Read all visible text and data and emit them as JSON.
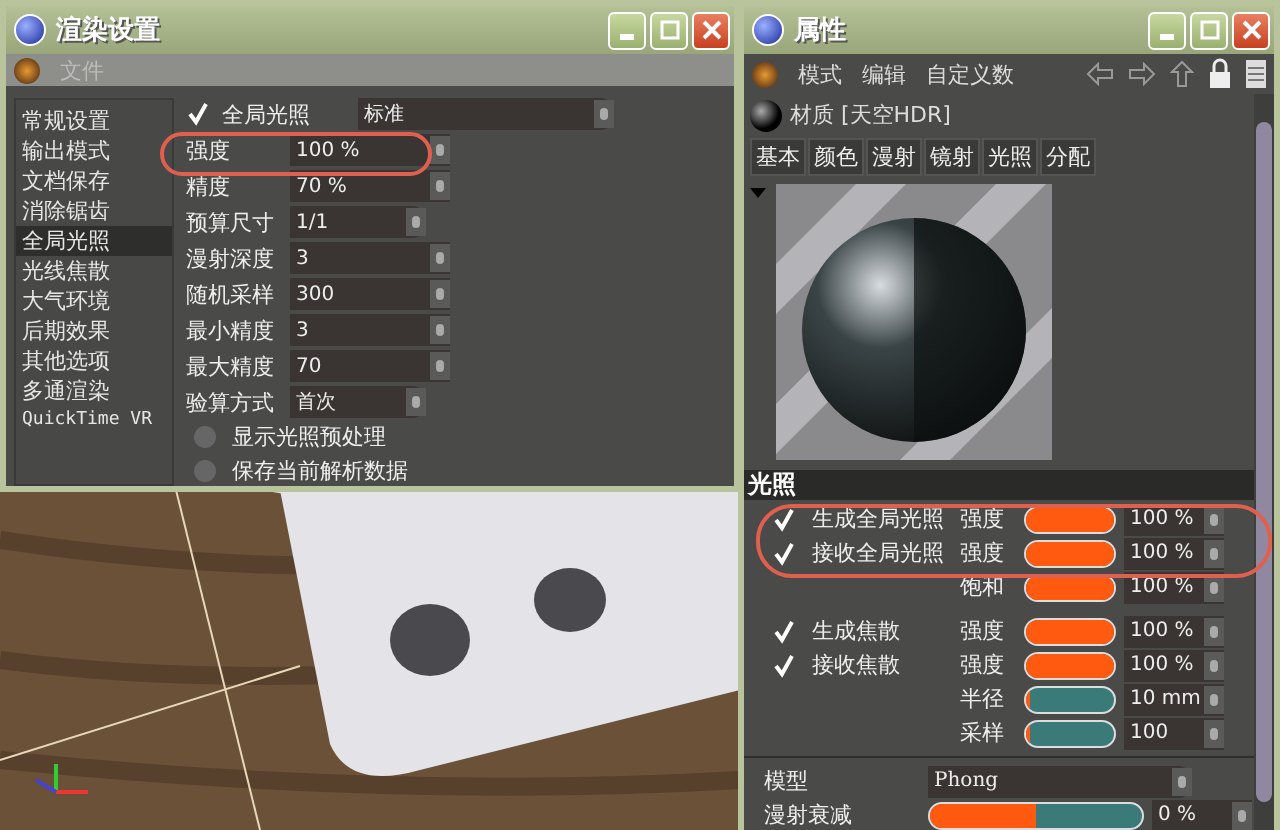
{
  "render_window": {
    "title": "渲染设置",
    "menu": [
      "文件"
    ],
    "sidebar": [
      {
        "label": "常规设置",
        "selected": false
      },
      {
        "label": "输出模式",
        "selected": false
      },
      {
        "label": "文档保存",
        "selected": false
      },
      {
        "label": "消除锯齿",
        "selected": false
      },
      {
        "label": "全局光照",
        "selected": true
      },
      {
        "label": "光线焦散",
        "selected": false
      },
      {
        "label": "大气环境",
        "selected": false
      },
      {
        "label": "后期效果",
        "selected": false
      },
      {
        "label": "其他选项",
        "selected": false
      },
      {
        "label": "多通渲染",
        "selected": false
      },
      {
        "label": "QuickTime VR",
        "selected": false
      }
    ],
    "settings": [
      {
        "kind": "check_dropdown",
        "label": "全局光照",
        "checked": true,
        "value": "标准"
      },
      {
        "kind": "spin",
        "label": "强度",
        "value": "100 %"
      },
      {
        "kind": "spin",
        "label": "精度",
        "value": "70 %"
      },
      {
        "kind": "dropdown",
        "label": "预算尺寸",
        "value": "1/1"
      },
      {
        "kind": "spin",
        "label": "漫射深度",
        "value": "3"
      },
      {
        "kind": "spin",
        "label": "随机采样",
        "value": "300"
      },
      {
        "kind": "spin",
        "label": "最小精度",
        "value": "3"
      },
      {
        "kind": "spin",
        "label": "最大精度",
        "value": "70"
      },
      {
        "kind": "dropdown",
        "label": "验算方式",
        "value": "首次"
      },
      {
        "kind": "radio",
        "label": "显示光照预处理",
        "checked": false
      },
      {
        "kind": "radio",
        "label": "保存当前解析数据",
        "checked": false
      }
    ]
  },
  "attributes_window": {
    "title": "属性",
    "menu": [
      "模式",
      "编辑",
      "自定义数"
    ],
    "material": "材质 [天空HDR]",
    "tabs": [
      {
        "label": "基本",
        "selected": false
      },
      {
        "label": "颜色",
        "selected": false
      },
      {
        "label": "漫射",
        "selected": false
      },
      {
        "label": "镜射",
        "selected": false
      },
      {
        "label": "光照",
        "selected": false
      },
      {
        "label": "分配",
        "selected": false
      }
    ],
    "section": "光照",
    "rows": [
      {
        "kind": "slider",
        "checked": true,
        "label": "生成全局光照",
        "param": "强度",
        "level": 1,
        "value": "100 %"
      },
      {
        "kind": "slider",
        "checked": true,
        "label": "接收全局光照",
        "param": "强度",
        "level": 1,
        "value": "100 %"
      },
      {
        "kind": "slider",
        "param": "饱和",
        "level": 1,
        "value": "100 %"
      },
      {
        "kind": "gap"
      },
      {
        "kind": "slider",
        "checked": true,
        "label": "生成焦散",
        "param": "强度",
        "level": 1,
        "value": "100 %"
      },
      {
        "kind": "slider",
        "checked": true,
        "label": "接收焦散",
        "param": "强度",
        "level": 1,
        "value": "100 %"
      },
      {
        "kind": "slider",
        "param": "半径",
        "level": 0.05,
        "value": "10 mm"
      },
      {
        "kind": "slider",
        "param": "采样",
        "level": 0.05,
        "value": "100"
      },
      {
        "kind": "divider"
      },
      {
        "kind": "dropdown",
        "label": "模型",
        "value": "Phong"
      },
      {
        "kind": "wide_slider",
        "label": "漫射衰减",
        "level": 0.5,
        "value": "0 %"
      }
    ]
  }
}
